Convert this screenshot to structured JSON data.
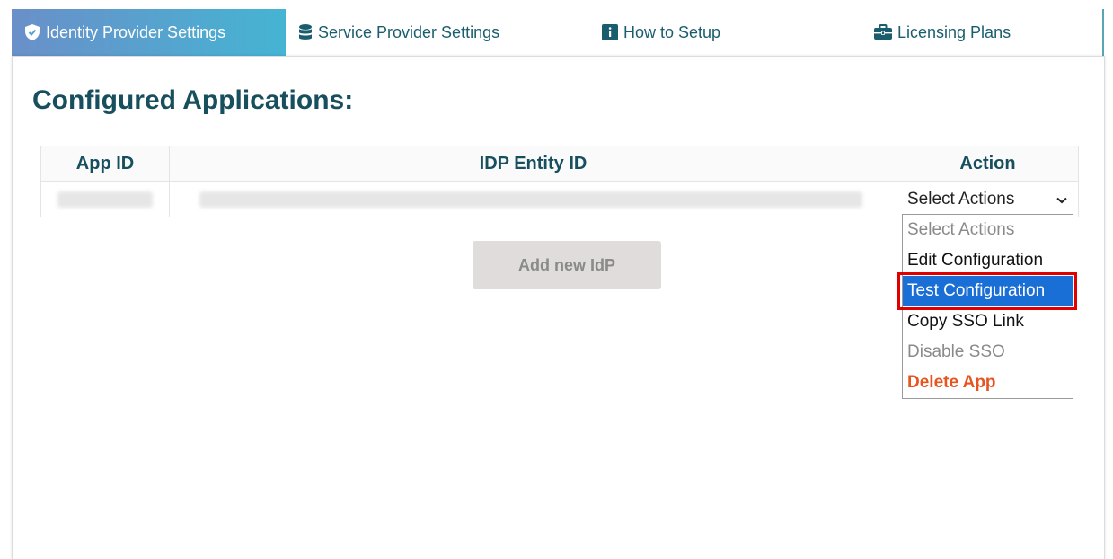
{
  "tabs": [
    {
      "label": "Identity Provider Settings",
      "icon": "shield-icon",
      "active": true
    },
    {
      "label": "Service Provider Settings",
      "icon": "database-icon",
      "active": false
    },
    {
      "label": "How to Setup",
      "icon": "info-icon",
      "active": false
    },
    {
      "label": "Licensing Plans",
      "icon": "briefcase-icon",
      "active": false
    }
  ],
  "page": {
    "heading": "Configured Applications:"
  },
  "table": {
    "headers": {
      "app_id": "App ID",
      "idp_entity_id": "IDP Entity ID",
      "action": "Action"
    },
    "select_value": "Select Actions"
  },
  "add_button": "Add new IdP",
  "dropdown": {
    "options": [
      {
        "label": "Select Actions",
        "state": "muted"
      },
      {
        "label": "Edit Configuration",
        "state": "normal"
      },
      {
        "label": "Test Configuration",
        "state": "selected"
      },
      {
        "label": "Copy SSO Link",
        "state": "normal"
      },
      {
        "label": "Disable SSO",
        "state": "muted"
      },
      {
        "label": "Delete App",
        "state": "danger"
      }
    ]
  },
  "colors": {
    "tab_gradient_start": "#6a8fc9",
    "tab_gradient_end": "#45b4d3",
    "heading": "#174f5e",
    "selected_option": "#1a6fd6",
    "delete_text": "#e8541f",
    "highlight_border": "#e00000"
  }
}
